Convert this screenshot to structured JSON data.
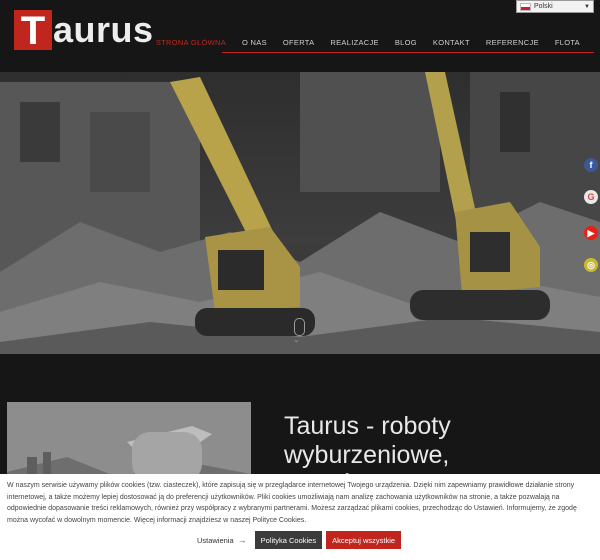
{
  "brand": {
    "logo_first": "T",
    "logo_rest": "aurus"
  },
  "language": {
    "selected": "Polski"
  },
  "nav": [
    "STRONA GŁÓWNA",
    "O NAS",
    "OFERTA",
    "REALIZACJE",
    "BLOG",
    "KONTAKT",
    "REFERENCJE",
    "FLOTA"
  ],
  "social": [
    "facebook-icon",
    "google-icon",
    "youtube-icon",
    "instagram-icon"
  ],
  "section": {
    "headline": "Taurus - roboty wyburzeniowe, rozbiórkowe"
  },
  "cookie": {
    "text": "W naszym serwisie używamy plików cookies (tzw. ciasteczek), które zapisują się w przeglądarce internetowej Twojego urządzenia. Dzięki nim zapewniamy prawidłowe działanie strony internetowej, a także możemy lepiej dostosować ją do preferencji użytkowników. Pliki cookies umożliwiają nam analizę zachowania użytkowników na stronie, a także pozwalają na odpowiednie dopasowanie treści reklamowych, również przy współpracy z wybranymi partnerami. Możesz zarządzać plikami cookies, przechodząc do Ustawień. Informujemy, że zgodę można wycofać w dowolnym momencie. Więcej informacji znajdziesz w naszej Polityce Cookies.",
    "settings_label": "Ustawienia",
    "policy_button": "Polityka Cookies",
    "accept_button": "Akceptuj wszystkie"
  },
  "colors": {
    "accent": "#c0261e",
    "header_bg": "#161616",
    "cookie_bg": "#ffffff"
  }
}
